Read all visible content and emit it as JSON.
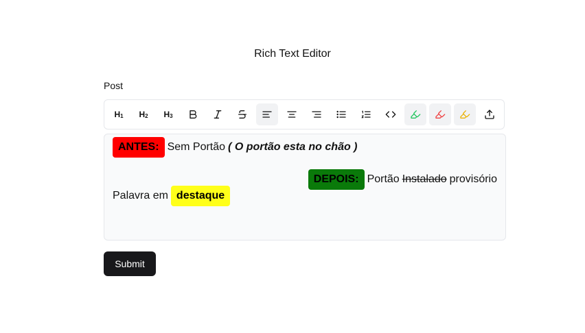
{
  "header": {
    "title": "Rich Text Editor"
  },
  "field": {
    "label": "Post"
  },
  "toolbar": {
    "h1_label": "H1",
    "h2_label": "H2",
    "h3_label": "H3",
    "highlight_colors": {
      "green": "#22c55e",
      "red": "#ef4444",
      "yellow": "#eab308"
    }
  },
  "content": {
    "line1": {
      "tag": "ANTES:",
      "text": "Sem Portão",
      "emphasis": "( O portão esta no chão )",
      "tag_color": "#ff0000"
    },
    "line2": {
      "tag": "DEPOIS:",
      "text_before": "Portão",
      "strike": "Instalado",
      "text_after": "provisório",
      "tag_color": "#0a7a0a"
    },
    "line3": {
      "text": "Palavra em",
      "highlight": "destaque",
      "highlight_color": "#ffff1a"
    }
  },
  "submit": {
    "label": "Submit"
  }
}
